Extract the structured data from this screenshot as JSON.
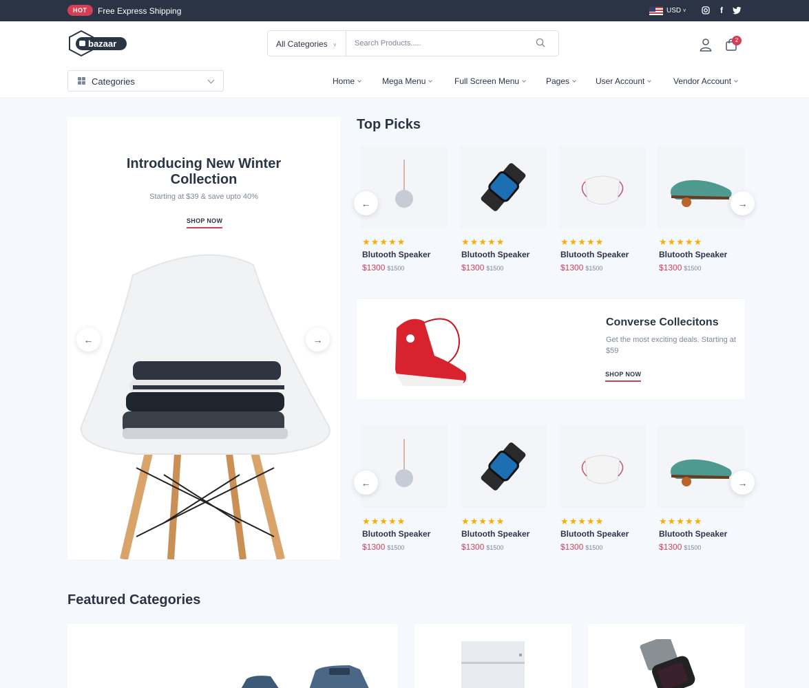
{
  "topbar": {
    "hot_label": "HOT",
    "shipping_text": "Free Express Shipping",
    "currency": "USD",
    "social": [
      "instagram-icon",
      "facebook-icon",
      "twitter-icon"
    ]
  },
  "header": {
    "logo_text": "bazaar",
    "search_category": "All Categories",
    "search_placeholder": "Search Products.....",
    "cart_count": "2"
  },
  "nav": {
    "categories_label": "Categories",
    "items": [
      "Home",
      "Mega Menu",
      "Full Screen Menu",
      "Pages",
      "User Account",
      "Vendor Account"
    ]
  },
  "hero": {
    "title": "Introducing New Winter Collection",
    "subtitle": "Starting at $39 & save upto 40%",
    "cta": "SHOP NOW"
  },
  "top_picks": {
    "title": "Top Picks",
    "products": [
      {
        "name": "Blutooth Speaker",
        "price": "$1300",
        "old_price": "$1500",
        "rating": 5,
        "image": "pendant-speaker"
      },
      {
        "name": "Blutooth Speaker",
        "price": "$1300",
        "old_price": "$1500",
        "rating": 5,
        "image": "smart-watch"
      },
      {
        "name": "Blutooth Speaker",
        "price": "$1300",
        "old_price": "$1500",
        "rating": 5,
        "image": "face-mask"
      },
      {
        "name": "Blutooth Speaker",
        "price": "$1300",
        "old_price": "$1500",
        "rating": 5,
        "image": "green-shoe"
      }
    ]
  },
  "banner": {
    "title": "Converse Collecitons",
    "subtitle": "Get the most exciting deals. Starting at $59",
    "cta": "SHOP NOW"
  },
  "featured": {
    "title": "Featured Categories"
  },
  "colors": {
    "dark": "#2b3445",
    "accent": "#d23f57",
    "star": "#faaf00",
    "muted": "#7d879c",
    "bg": "#f5f8fc"
  }
}
